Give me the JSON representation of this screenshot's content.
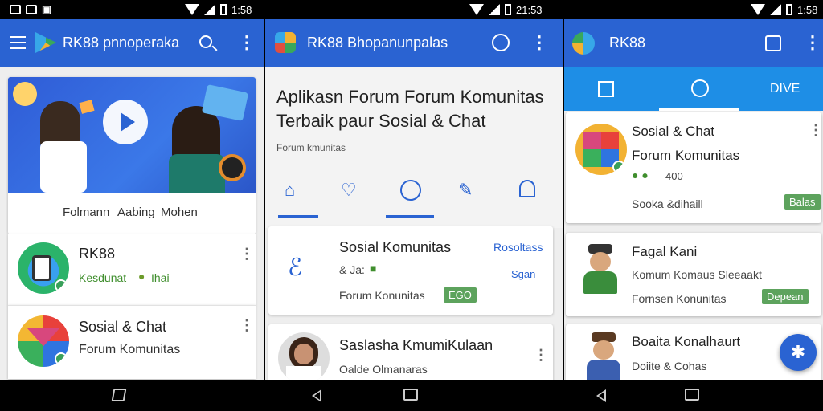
{
  "status": {
    "left": {
      "time": "1:58"
    },
    "mid": {
      "time": "21:53"
    },
    "right": {
      "time": "1:58"
    }
  },
  "panel1": {
    "title": "RK88 pnnoperaka",
    "banner_links": [
      "Folmann",
      "Aabing",
      "Mohen"
    ],
    "items": [
      {
        "title": "RK88",
        "sub": "Kesdunat",
        "sub2": "Ihai"
      },
      {
        "title": "Sosial & Chat",
        "sub": "Forum Komunitas"
      }
    ]
  },
  "panel2": {
    "title": "RK88 Bhopanunpalas",
    "headline1": "Aplikasn Forum Forum Komunitas",
    "headline2": "Terbaik paur Sosial & Chat",
    "caption": "Forum kmunitas",
    "cards": [
      {
        "title": "Sosial Komunitas",
        "line2": "& Ja:",
        "line3": "Forum Konunitas",
        "right1": "Rosoltass",
        "right2": "Sgan",
        "badge": "EGO"
      },
      {
        "title": "Saslasha KmumiKulaan",
        "line2": "Oalde Olmanaras"
      }
    ]
  },
  "panel3": {
    "title": "RK88",
    "tab_label": "DIVE",
    "cards": [
      {
        "title": "Sosial & Chat",
        "sub": "Forum Komunitas",
        "count": "400",
        "line3": "Sooka &dihaill",
        "badge": "Balas"
      },
      {
        "title": "Fagal Kani",
        "sub": "Komum Komaus Sleeaakt",
        "line3": "Fornsen Konunitas",
        "badge": "Depean"
      },
      {
        "title": "Boaita Konalhaurt",
        "sub": "Doiite & Cohas"
      }
    ]
  },
  "colors": {
    "primary": "#2a63d2",
    "tab_blue": "#1e8ee6",
    "badge_green": "#5da35d"
  }
}
